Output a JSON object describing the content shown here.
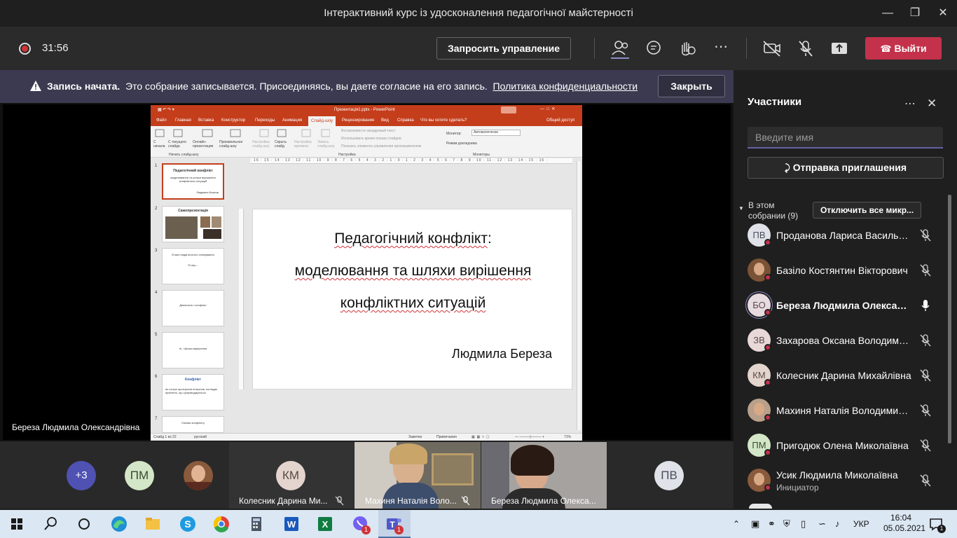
{
  "window": {
    "title": "Інтерактивний курс із удосконалення педагогічної майстерності"
  },
  "controls": {
    "timer": "31:56",
    "request_control": "Запросить управление",
    "leave": "Выйти"
  },
  "banner": {
    "bold": "Запись начата.",
    "text": "Это собрание записывается. Присоединяясь, вы даете согласие на его запись.",
    "link": "Политика конфиденциальности",
    "close": "Закрыть"
  },
  "stage": {
    "presenter": "Береза Людмила Олександрівна"
  },
  "ppt": {
    "doc_title": "Презентація1.pptx - PowerPoint",
    "tabs": [
      "Файл",
      "Главная",
      "Вставка",
      "Конструктор",
      "Переходы",
      "Анимация",
      "Слайд-шоу",
      "Рецензирование",
      "Вид",
      "Справка",
      "Что вы хотите сделать?",
      "Общий доступ"
    ],
    "active_tab": "Слайд-шоу",
    "ribbon": [
      "С начала",
      "С текущего слайда",
      "Онлайн-презентация",
      "Произвольное слайд-шоу",
      "Настройка слайд-шоу",
      "Скрыть слайд",
      "Настройка времени",
      "Запись слайд-шоу",
      "Воспроизвести закадровый текст",
      "Использовать время показа слайдов",
      "Показать элементы управления проигрывателем",
      "Монитор:",
      "Автоматически",
      "Режим докладчика",
      "Начать слайд-шоу",
      "Настройка",
      "Мониторы"
    ],
    "thumbs": [
      {
        "num": "1",
        "title": "Педагогічний конфлікт",
        "sub": "моделювання та шляхи вирішення конфліктних ситуацій",
        "auth": "Людмила Береза"
      },
      {
        "num": "2",
        "title": "Самопрезентація",
        "sub": "",
        "auth": ""
      },
      {
        "num": "3",
        "title": "",
        "sub": "Етапи педагогічного спілкування",
        "auth": "Пі пер..."
      },
      {
        "num": "4",
        "title": "",
        "sub": "Діяльність і конфлікт",
        "auth": ""
      },
      {
        "num": "5",
        "title": "",
        "sub": "Ін.. Шляхи вирішення",
        "auth": ""
      },
      {
        "num": "6",
        "title": "Конфлікт",
        "sub": "як гостре протиріччя інтересів, поглядів, прагнень, що супроводжується",
        "auth": ""
      },
      {
        "num": "7",
        "title": "",
        "sub": "Ознаки конфлікту",
        "auth": ""
      }
    ],
    "slide": {
      "title_a": "Педагогічний конфлікт",
      "title_b": ":",
      "line2": "моделювання та шляхи вирішення",
      "line3": "конфліктних ситуацій",
      "author": "Людмила Береза"
    },
    "status": {
      "slide_info": "Слайд 1 из 22",
      "lang": "русский",
      "notes": "Заметки",
      "comments": "Примечания",
      "zoom": "71%"
    }
  },
  "gallery": {
    "overflow": "+3",
    "pm": "ПМ",
    "km_initials": "КМ",
    "km_name": "Колесник Дарина Ми...",
    "v1_name": "Махиня Наталія Воло...",
    "v2_name": "Береза Людмила Олекса...",
    "pv": "ПВ"
  },
  "panel": {
    "title": "Участники",
    "search_placeholder": "Введите имя",
    "invite": "Отправка приглашения",
    "section_line1": "В этом",
    "section_line2": "собрании (9)",
    "mute_all": "Отключить все микр...",
    "participants": [
      {
        "initials": "ПВ",
        "name": "Проданова Лариса Васильевна",
        "mic": "muted",
        "bold": false
      },
      {
        "initials": "",
        "name": "Базіло Костянтин Вікторович",
        "mic": "muted",
        "bold": false
      },
      {
        "initials": "БО",
        "name": "Береза Людмила Олександ...",
        "mic": "on",
        "bold": true
      },
      {
        "initials": "ЗВ",
        "name": "Захарова Оксана Володими...",
        "mic": "muted",
        "bold": false
      },
      {
        "initials": "КМ",
        "name": "Колесник Дарина Михайлівна",
        "mic": "muted",
        "bold": false
      },
      {
        "initials": "",
        "name": "Махиня Наталія Володимирі...",
        "mic": "muted",
        "bold": false
      },
      {
        "initials": "ПМ",
        "name": "Пригодюк Олена Миколаївна",
        "mic": "muted",
        "bold": false
      },
      {
        "initials": "",
        "name": "Усик Людмила Миколаївна",
        "role": "Инициатор",
        "mic": "muted",
        "bold": false
      }
    ]
  },
  "taskbar": {
    "lang": "УКР",
    "time": "16:04",
    "date": "05.05.2021",
    "badges": {
      "viber": "1",
      "teams": "1",
      "notifications": "1"
    }
  },
  "colors": {
    "accent": "#6264a7",
    "leave": "#c4314b",
    "ppt": "#c43e1c",
    "banner": "#3b3a50"
  }
}
